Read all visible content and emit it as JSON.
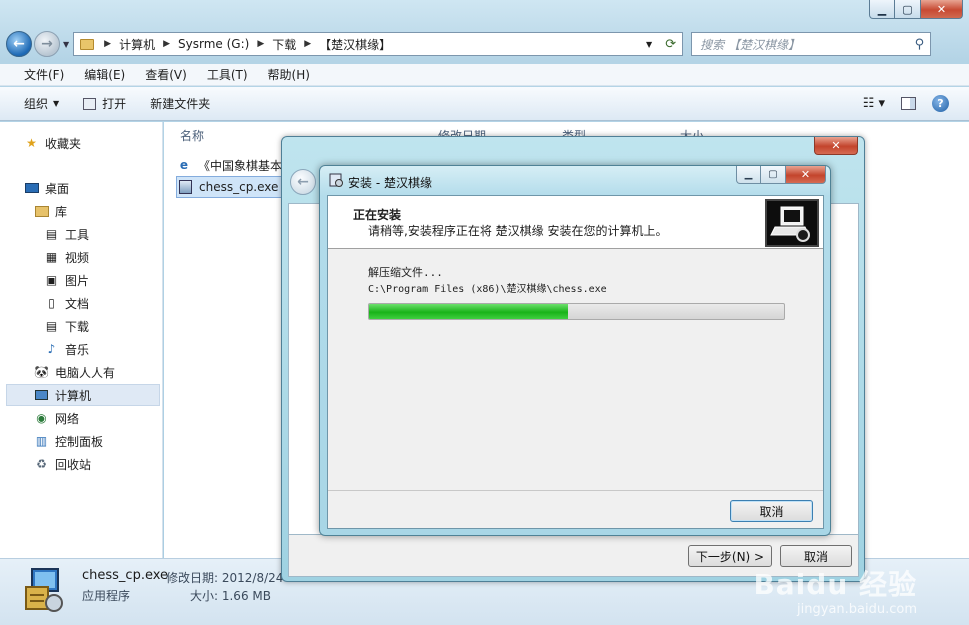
{
  "explorer": {
    "address": {
      "crumbs": [
        "计算机",
        "Sysrme (G:)",
        "下载",
        "【楚汉棋缘】"
      ]
    },
    "search_placeholder": "搜索 【楚汉棋缘】",
    "menu": [
      "文件(F)",
      "编辑(E)",
      "查看(V)",
      "工具(T)",
      "帮助(H)"
    ],
    "toolbar": {
      "organize": "组织",
      "open": "打开",
      "new_folder": "新建文件夹"
    },
    "nav": {
      "favorites": "收藏夹",
      "desktop": "桌面",
      "libraries": "库",
      "tools": "工具",
      "videos": "视频",
      "pictures": "图片",
      "documents": "文档",
      "downloads": "下载",
      "music": "音乐",
      "user": "电脑人人有",
      "computer": "计算机",
      "network": "网络",
      "control_panel": "控制面板",
      "recycle": "回收站"
    },
    "columns": {
      "name": "名称",
      "modified": "修改日期",
      "type": "类型",
      "size": "大小"
    },
    "files": [
      {
        "name": "《中国象棋基本"
      },
      {
        "name": "chess_cp.exe"
      }
    ],
    "details": {
      "filename": "chess_cp.exe",
      "type": "应用程序",
      "modified": "修改日期: 2012/8/24",
      "size": "大小: 1.66 MB"
    }
  },
  "outer_installer": {
    "next_button": "下一步(N) >",
    "cancel_button": "取消"
  },
  "installer": {
    "title": "安装 - 楚汉棋缘",
    "heading": "正在安装",
    "subheading": "请稍等,安装程序正在将 楚汉棋缘 安装在您的计算机上。",
    "status_line": "解压缩文件...",
    "current_file": "C:\\Program Files (x86)\\楚汉棋缘\\chess.exe",
    "progress": 0.48,
    "cancel_button": "取消"
  },
  "watermark": {
    "brand": "Baidu 经验",
    "url": "jingyan.baidu.com"
  }
}
